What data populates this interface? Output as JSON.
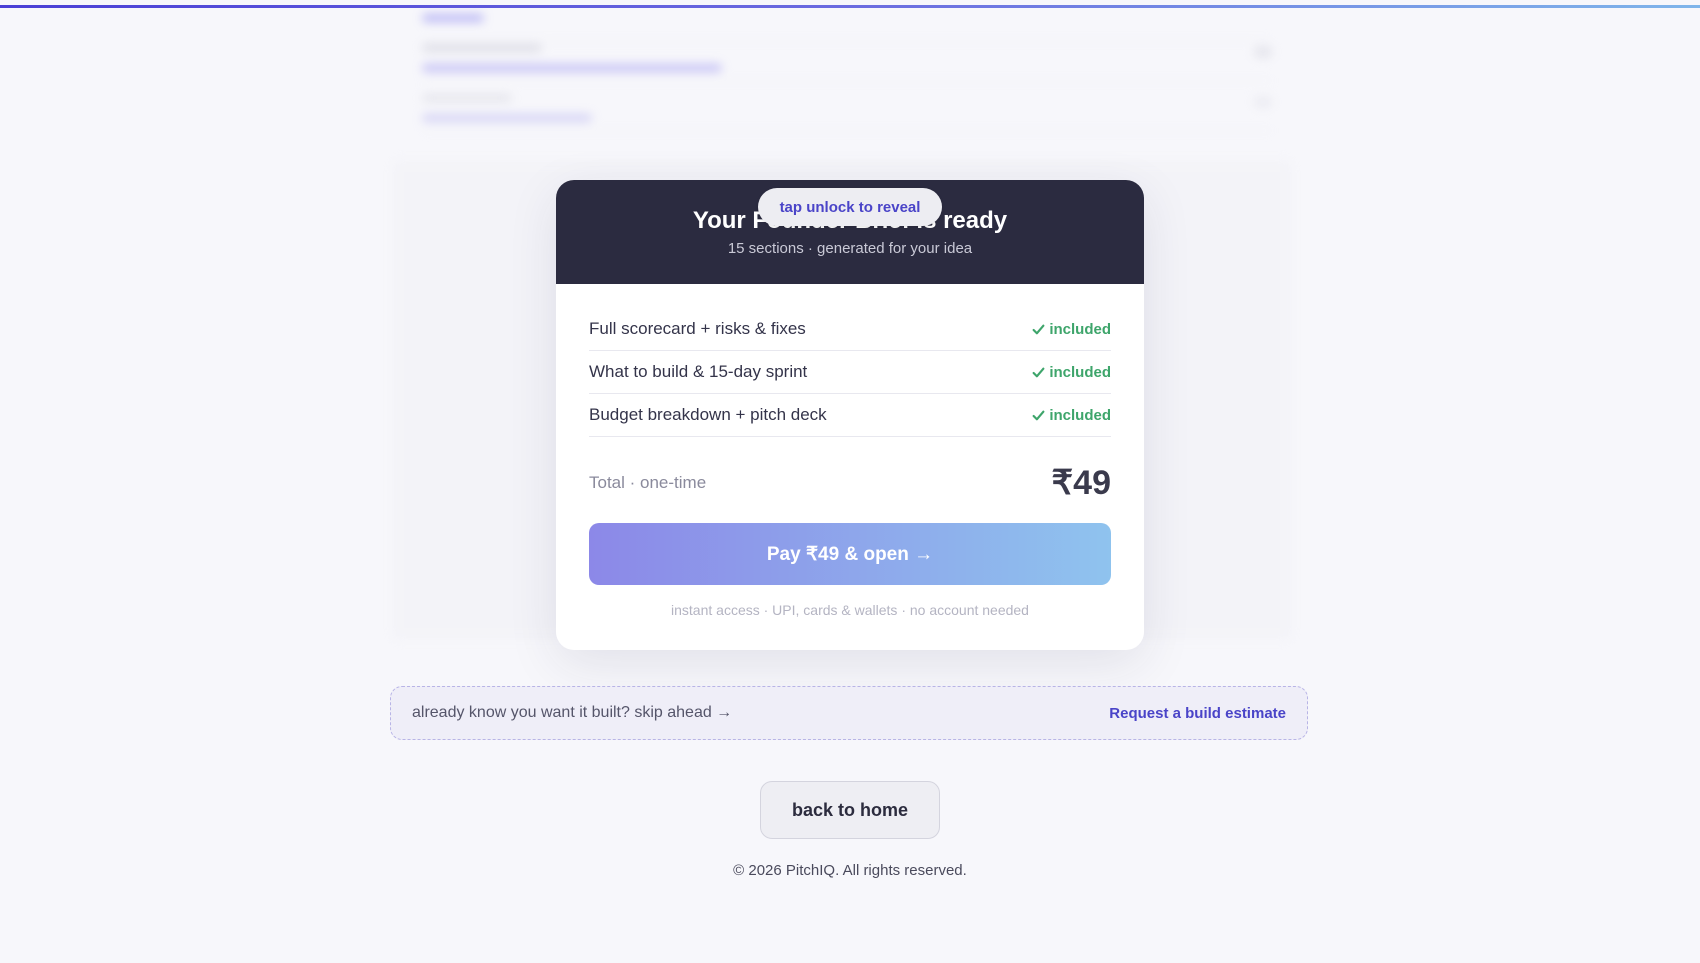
{
  "card": {
    "title": "Your Founder Brief is ready",
    "subtitle": "15 sections · generated for your idea",
    "reveal_label": "tap unlock to reveal",
    "items": [
      {
        "label": "Full scorecard + risks & fixes",
        "status": "included"
      },
      {
        "label": "What to build & 15-day sprint",
        "status": "included"
      },
      {
        "label": "Budget breakdown + pitch deck",
        "status": "included"
      }
    ],
    "total_label": "Total · one-time",
    "total_price": "₹49",
    "pay_button": "Pay ₹49 & open →",
    "pay_note": "instant access · UPI, cards & wallets · no account needed"
  },
  "skip": {
    "text": "already know you want it built? skip ahead →",
    "link": "Request a build estimate"
  },
  "home_button": "back to home",
  "footer": "© 2026 PitchIQ. All rights reserved.",
  "colors": {
    "accent": "#4a44c8",
    "success": "#3ea56b",
    "header_bg": "#2b2b40"
  }
}
